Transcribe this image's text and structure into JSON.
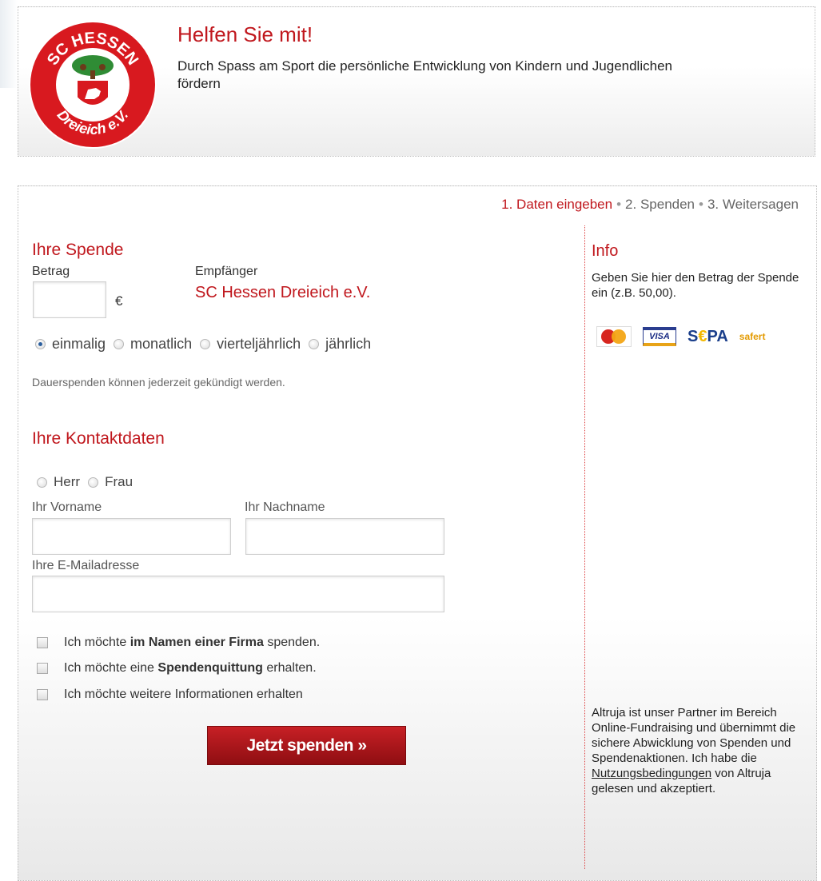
{
  "header": {
    "logo_top_text": "SC HESSEN",
    "logo_bottom_text": "Dreieich e.V.",
    "title": "Helfen Sie mit!",
    "subtitle": "Durch Spass am Sport die persönliche Entwicklung von Kindern und Jugendlichen fördern"
  },
  "steps": {
    "step1": "1. Daten eingeben",
    "step2": "2. Spenden",
    "step3": "3. Weitersagen",
    "separator": "•"
  },
  "donation": {
    "section_title": "Ihre Spende",
    "amount_label": "Betrag",
    "amount_value": "",
    "currency": "€",
    "recipient_label": "Empfänger",
    "recipient_name": "SC Hessen Dreieich e.V.",
    "frequency_options": [
      "einmalig",
      "monatlich",
      "vierteljährlich",
      "jährlich"
    ],
    "frequency_selected": "einmalig",
    "recurring_note": "Dauerspenden können jederzeit gekündigt werden."
  },
  "contact": {
    "section_title": "Ihre Kontaktdaten",
    "salutation_options": [
      "Herr",
      "Frau"
    ],
    "firstname_label": "Ihr Vorname",
    "firstname_value": "",
    "lastname_label": "Ihr Nachname",
    "lastname_value": "",
    "email_label": "Ihre E-Mailadresse",
    "email_value": ""
  },
  "checkboxes": {
    "company_pre": "Ich möchte ",
    "company_bold": "im Namen einer Firma",
    "company_post": " spenden.",
    "receipt_pre": "Ich möchte eine ",
    "receipt_bold": "Spendenquittung",
    "receipt_post": " erhalten.",
    "info": "Ich möchte weitere Informationen erhalten"
  },
  "submit_label": "Jetzt spenden »",
  "info": {
    "title": "Info",
    "text": "Geben Sie hier den Betrag der Spende ein (z.B. 50,00).",
    "payment_icons": [
      "mastercard-icon",
      "visa-icon",
      "sepa-icon",
      "safer-pay-icon"
    ],
    "payment_labels": {
      "visa": "VISA",
      "sepa_s": "S",
      "sepa_e": "€",
      "sepa_pa": "PA",
      "safer": "safert"
    },
    "partner_text_pre": "Altruja ist unser Partner im Bereich Online-Fundraising und übernimmt die sichere Abwicklung von Spenden und Spendenaktionen. Ich habe die ",
    "partner_link": "Nutzungsbedingungen",
    "partner_text_post": " von Altruja gelesen und akzeptiert."
  },
  "colors": {
    "accent": "#c0171d",
    "button_top": "#c72025",
    "button_bottom": "#8f0e12"
  }
}
